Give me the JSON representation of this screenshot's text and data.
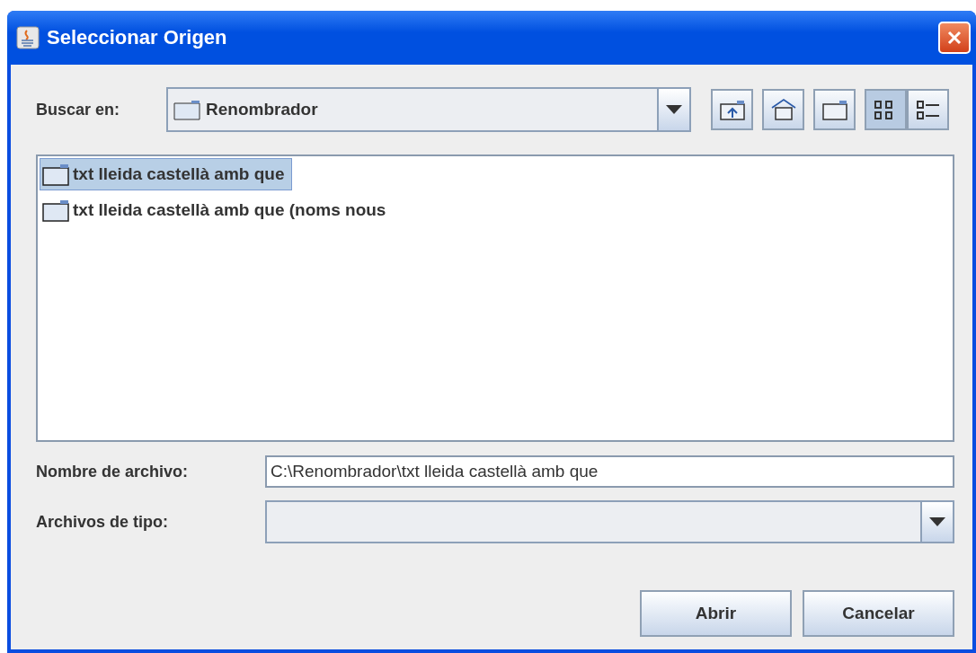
{
  "window": {
    "title": "Seleccionar Origen"
  },
  "look_in": {
    "label": "Buscar en:",
    "value": "Renombrador"
  },
  "toolbar": [
    {
      "kind": "up"
    },
    {
      "kind": "home"
    },
    {
      "kind": "new-folder"
    },
    {
      "kind": "list",
      "selected": true
    },
    {
      "kind": "details",
      "selected": false
    }
  ],
  "files": [
    {
      "name": "txt lleida castellà amb que",
      "selected": true
    },
    {
      "name": "txt lleida castellà amb que (noms nous",
      "selected": false
    }
  ],
  "file_name": {
    "label": "Nombre de archivo:",
    "value": "C:\\Renombrador\\txt lleida castellà amb que"
  },
  "file_type": {
    "label": "Archivos de tipo:"
  },
  "buttons": [
    "Abrir",
    "Cancelar"
  ]
}
